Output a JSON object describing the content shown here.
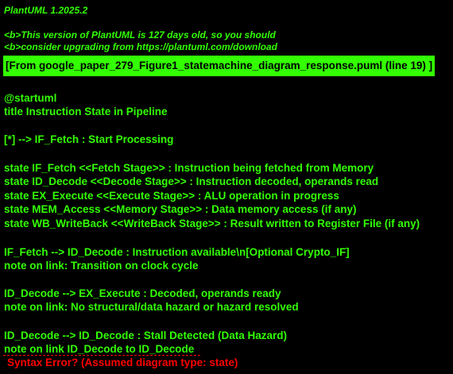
{
  "header": {
    "version": "PlantUML 1.2025.2",
    "warning_line1": "<b>This version of PlantUML is 127 days old, so you should",
    "warning_line2": "<b>consider upgrading from https://plantuml.com/download"
  },
  "source_banner": "[From google_paper_279_Figure1_statemachine_diagram_response.puml (line 19) ]",
  "source_lines": [
    "@startuml",
    "title Instruction State in Pipeline",
    "[*] --> IF_Fetch : Start Processing",
    "state IF_Fetch <<Fetch Stage>> : Instruction being fetched from Memory",
    "state ID_Decode <<Decode Stage>> : Instruction decoded, operands read",
    "state EX_Execute <<Execute Stage>> : ALU operation in progress",
    "state MEM_Access <<Memory Stage>> : Data memory access (if any)",
    "state WB_WriteBack <<WriteBack Stage>> : Result written to Register File (if any)",
    "IF_Fetch --> ID_Decode : Instruction available\\n[Optional Crypto_IF]",
    "note on link: Transition on clock cycle",
    "ID_Decode --> EX_Execute : Decoded, operands ready",
    "note on link: No structural/data hazard or hazard resolved",
    "ID_Decode --> ID_Decode : Stall Detected (Data Hazard)",
    "note on link ID_Decode to ID_Decode"
  ],
  "error_message": "Syntax Error? (Assumed diagram type: state)",
  "colors": {
    "background": "#000000",
    "text": "#33ff02",
    "error": "#ff0000"
  }
}
